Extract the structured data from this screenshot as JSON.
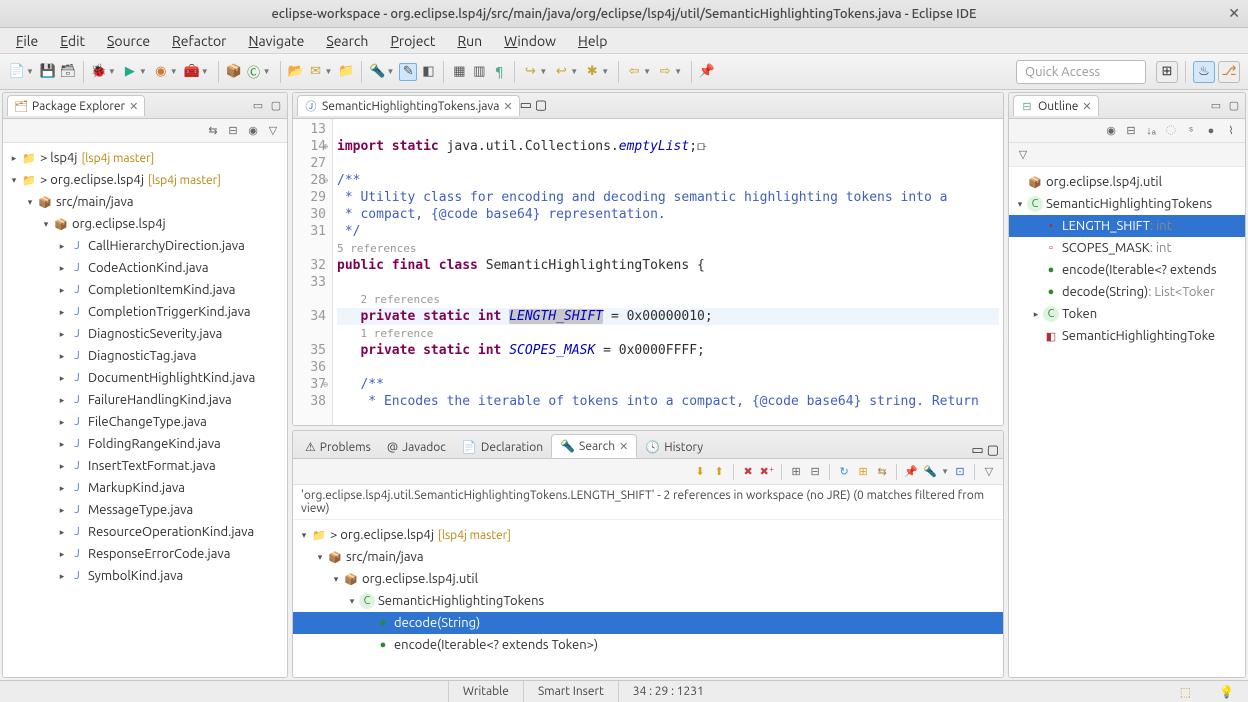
{
  "window": {
    "title": "eclipse-workspace - org.eclipse.lsp4j/src/main/java/org/eclipse/lsp4j/util/SemanticHighlightingTokens.java - Eclipse IDE"
  },
  "menu": [
    "File",
    "Edit",
    "Source",
    "Refactor",
    "Navigate",
    "Search",
    "Project",
    "Run",
    "Window",
    "Help"
  ],
  "quickAccess": "Quick Access",
  "packageExplorer": {
    "title": "Package Explorer",
    "items": [
      {
        "d": 0,
        "tw": "▸",
        "ic": "📁",
        "label": "> lsp4j",
        "decor": "[lsp4j master]"
      },
      {
        "d": 0,
        "tw": "▾",
        "ic": "📁",
        "label": "> org.eclipse.lsp4j",
        "decor": "[lsp4j master]"
      },
      {
        "d": 1,
        "tw": "▾",
        "ic": "📦",
        "label": "src/main/java"
      },
      {
        "d": 2,
        "tw": "▾",
        "ic": "📦",
        "label": "org.eclipse.lsp4j"
      },
      {
        "d": 3,
        "tw": "▸",
        "ic": "J",
        "label": "CallHierarchyDirection.java"
      },
      {
        "d": 3,
        "tw": "▸",
        "ic": "J",
        "label": "CodeActionKind.java"
      },
      {
        "d": 3,
        "tw": "▸",
        "ic": "J",
        "label": "CompletionItemKind.java"
      },
      {
        "d": 3,
        "tw": "▸",
        "ic": "J",
        "label": "CompletionTriggerKind.java"
      },
      {
        "d": 3,
        "tw": "▸",
        "ic": "J",
        "label": "DiagnosticSeverity.java"
      },
      {
        "d": 3,
        "tw": "▸",
        "ic": "J",
        "label": "DiagnosticTag.java"
      },
      {
        "d": 3,
        "tw": "▸",
        "ic": "J",
        "label": "DocumentHighlightKind.java"
      },
      {
        "d": 3,
        "tw": "▸",
        "ic": "J",
        "label": "FailureHandlingKind.java"
      },
      {
        "d": 3,
        "tw": "▸",
        "ic": "J",
        "label": "FileChangeType.java"
      },
      {
        "d": 3,
        "tw": "▸",
        "ic": "J",
        "label": "FoldingRangeKind.java"
      },
      {
        "d": 3,
        "tw": "▸",
        "ic": "J",
        "label": "InsertTextFormat.java"
      },
      {
        "d": 3,
        "tw": "▸",
        "ic": "J",
        "label": "MarkupKind.java"
      },
      {
        "d": 3,
        "tw": "▸",
        "ic": "J",
        "label": "MessageType.java"
      },
      {
        "d": 3,
        "tw": "▸",
        "ic": "J",
        "label": "ResourceOperationKind.java"
      },
      {
        "d": 3,
        "tw": "▸",
        "ic": "J",
        "label": "ResponseErrorCode.java"
      },
      {
        "d": 3,
        "tw": "▸",
        "ic": "J",
        "label": "SymbolKind.java"
      }
    ]
  },
  "editor": {
    "tab": "SemanticHighlightingTokens.java",
    "lines": [
      {
        "n": "13",
        "html": ""
      },
      {
        "n": "14",
        "fold": "⊕",
        "html": "<span class='kw'>import static</span> java.util.Collections.<span class='ital'>emptyList</span>;⟥"
      },
      {
        "n": "27",
        "html": ""
      },
      {
        "n": "28",
        "fold": "⊖",
        "html": "<span class='com'>/**</span>"
      },
      {
        "n": "29",
        "html": "<span class='com'> * Utility class for encoding and decoding semantic highlighting tokens into a</span>"
      },
      {
        "n": "30",
        "html": "<span class='com'> * compact, {@code base64} representation.</span>"
      },
      {
        "n": "31",
        "html": "<span class='com'> */</span>"
      },
      {
        "n": "",
        "html": "<span class='codelens'>5 references</span>"
      },
      {
        "n": "32",
        "html": "<span class='kw'>public final class</span> SemanticHighlightingTokens {"
      },
      {
        "n": "33",
        "html": ""
      },
      {
        "n": "",
        "html": "   <span class='codelens'>2 references</span>"
      },
      {
        "n": "34",
        "cur": true,
        "html": "   <span class='kw'>private static int</span> <span class='ital hl'>LENGTH_SHIFT</span> = 0x00000010;"
      },
      {
        "n": "",
        "html": "   <span class='codelens'>1 reference</span>"
      },
      {
        "n": "35",
        "html": "   <span class='kw'>private static int</span> <span class='ital'>SCOPES_MASK</span> = 0x0000FFFF;"
      },
      {
        "n": "36",
        "html": ""
      },
      {
        "n": "37",
        "fold": "⊖",
        "html": "   <span class='com'>/**</span>"
      },
      {
        "n": "38",
        "html": "   <span class='com'> * Encodes the iterable of tokens into a compact, {@code base64} string. Return</span>"
      }
    ]
  },
  "outline": {
    "title": "Outline",
    "items": [
      {
        "d": 0,
        "tw": "",
        "ic": "📦",
        "label": "org.eclipse.lsp4j.util"
      },
      {
        "d": 0,
        "tw": "▾",
        "ic": "C",
        "label": "SemanticHighlightingTokens",
        "cls": "ic-class"
      },
      {
        "d": 1,
        "tw": "",
        "ic": "▪",
        "label": "LENGTH_SHIFT",
        "type": ": int",
        "sel": true,
        "cls": "ic-field"
      },
      {
        "d": 1,
        "tw": "",
        "ic": "▫",
        "label": "SCOPES_MASK",
        "type": ": int",
        "cls": "ic-field"
      },
      {
        "d": 1,
        "tw": "",
        "ic": "●",
        "label": "encode(Iterable<? extends",
        "cls": "ic-method"
      },
      {
        "d": 1,
        "tw": "",
        "ic": "●",
        "label": "decode(String)",
        "type": ": List<Toker",
        "cls": "ic-method"
      },
      {
        "d": 1,
        "tw": "▸",
        "ic": "C",
        "label": "Token",
        "cls": "ic-class"
      },
      {
        "d": 1,
        "tw": "",
        "ic": "◧",
        "label": "SemanticHighlightingToke",
        "cls": "ic-field"
      }
    ]
  },
  "bottomTabs": [
    {
      "ic": "⚠",
      "label": "Problems"
    },
    {
      "ic": "@",
      "label": "Javadoc"
    },
    {
      "ic": "📄",
      "label": "Declaration"
    },
    {
      "ic": "🔦",
      "label": "Search",
      "active": true
    },
    {
      "ic": "🕓",
      "label": "History"
    }
  ],
  "search": {
    "desc": "'org.eclipse.lsp4j.util.SemanticHighlightingTokens.LENGTH_SHIFT' - 2 references in workspace (no JRE) (0 matches filtered from view)",
    "items": [
      {
        "d": 0,
        "tw": "▾",
        "ic": "📁",
        "label": "> org.eclipse.lsp4j",
        "decor": "[lsp4j master]"
      },
      {
        "d": 1,
        "tw": "▾",
        "ic": "📦",
        "label": "src/main/java"
      },
      {
        "d": 2,
        "tw": "▾",
        "ic": "📦",
        "label": "org.eclipse.lsp4j.util"
      },
      {
        "d": 3,
        "tw": "▾",
        "ic": "C",
        "label": "SemanticHighlightingTokens",
        "cls": "ic-class"
      },
      {
        "d": 4,
        "tw": "",
        "ic": "●",
        "label": "decode(String)",
        "sel": true,
        "cls": "ic-method"
      },
      {
        "d": 4,
        "tw": "",
        "ic": "●",
        "label": "encode(Iterable<? extends Token>)",
        "cls": "ic-method"
      }
    ]
  },
  "status": {
    "writable": "Writable",
    "insert": "Smart Insert",
    "pos": "34 : 29 : 1231"
  }
}
